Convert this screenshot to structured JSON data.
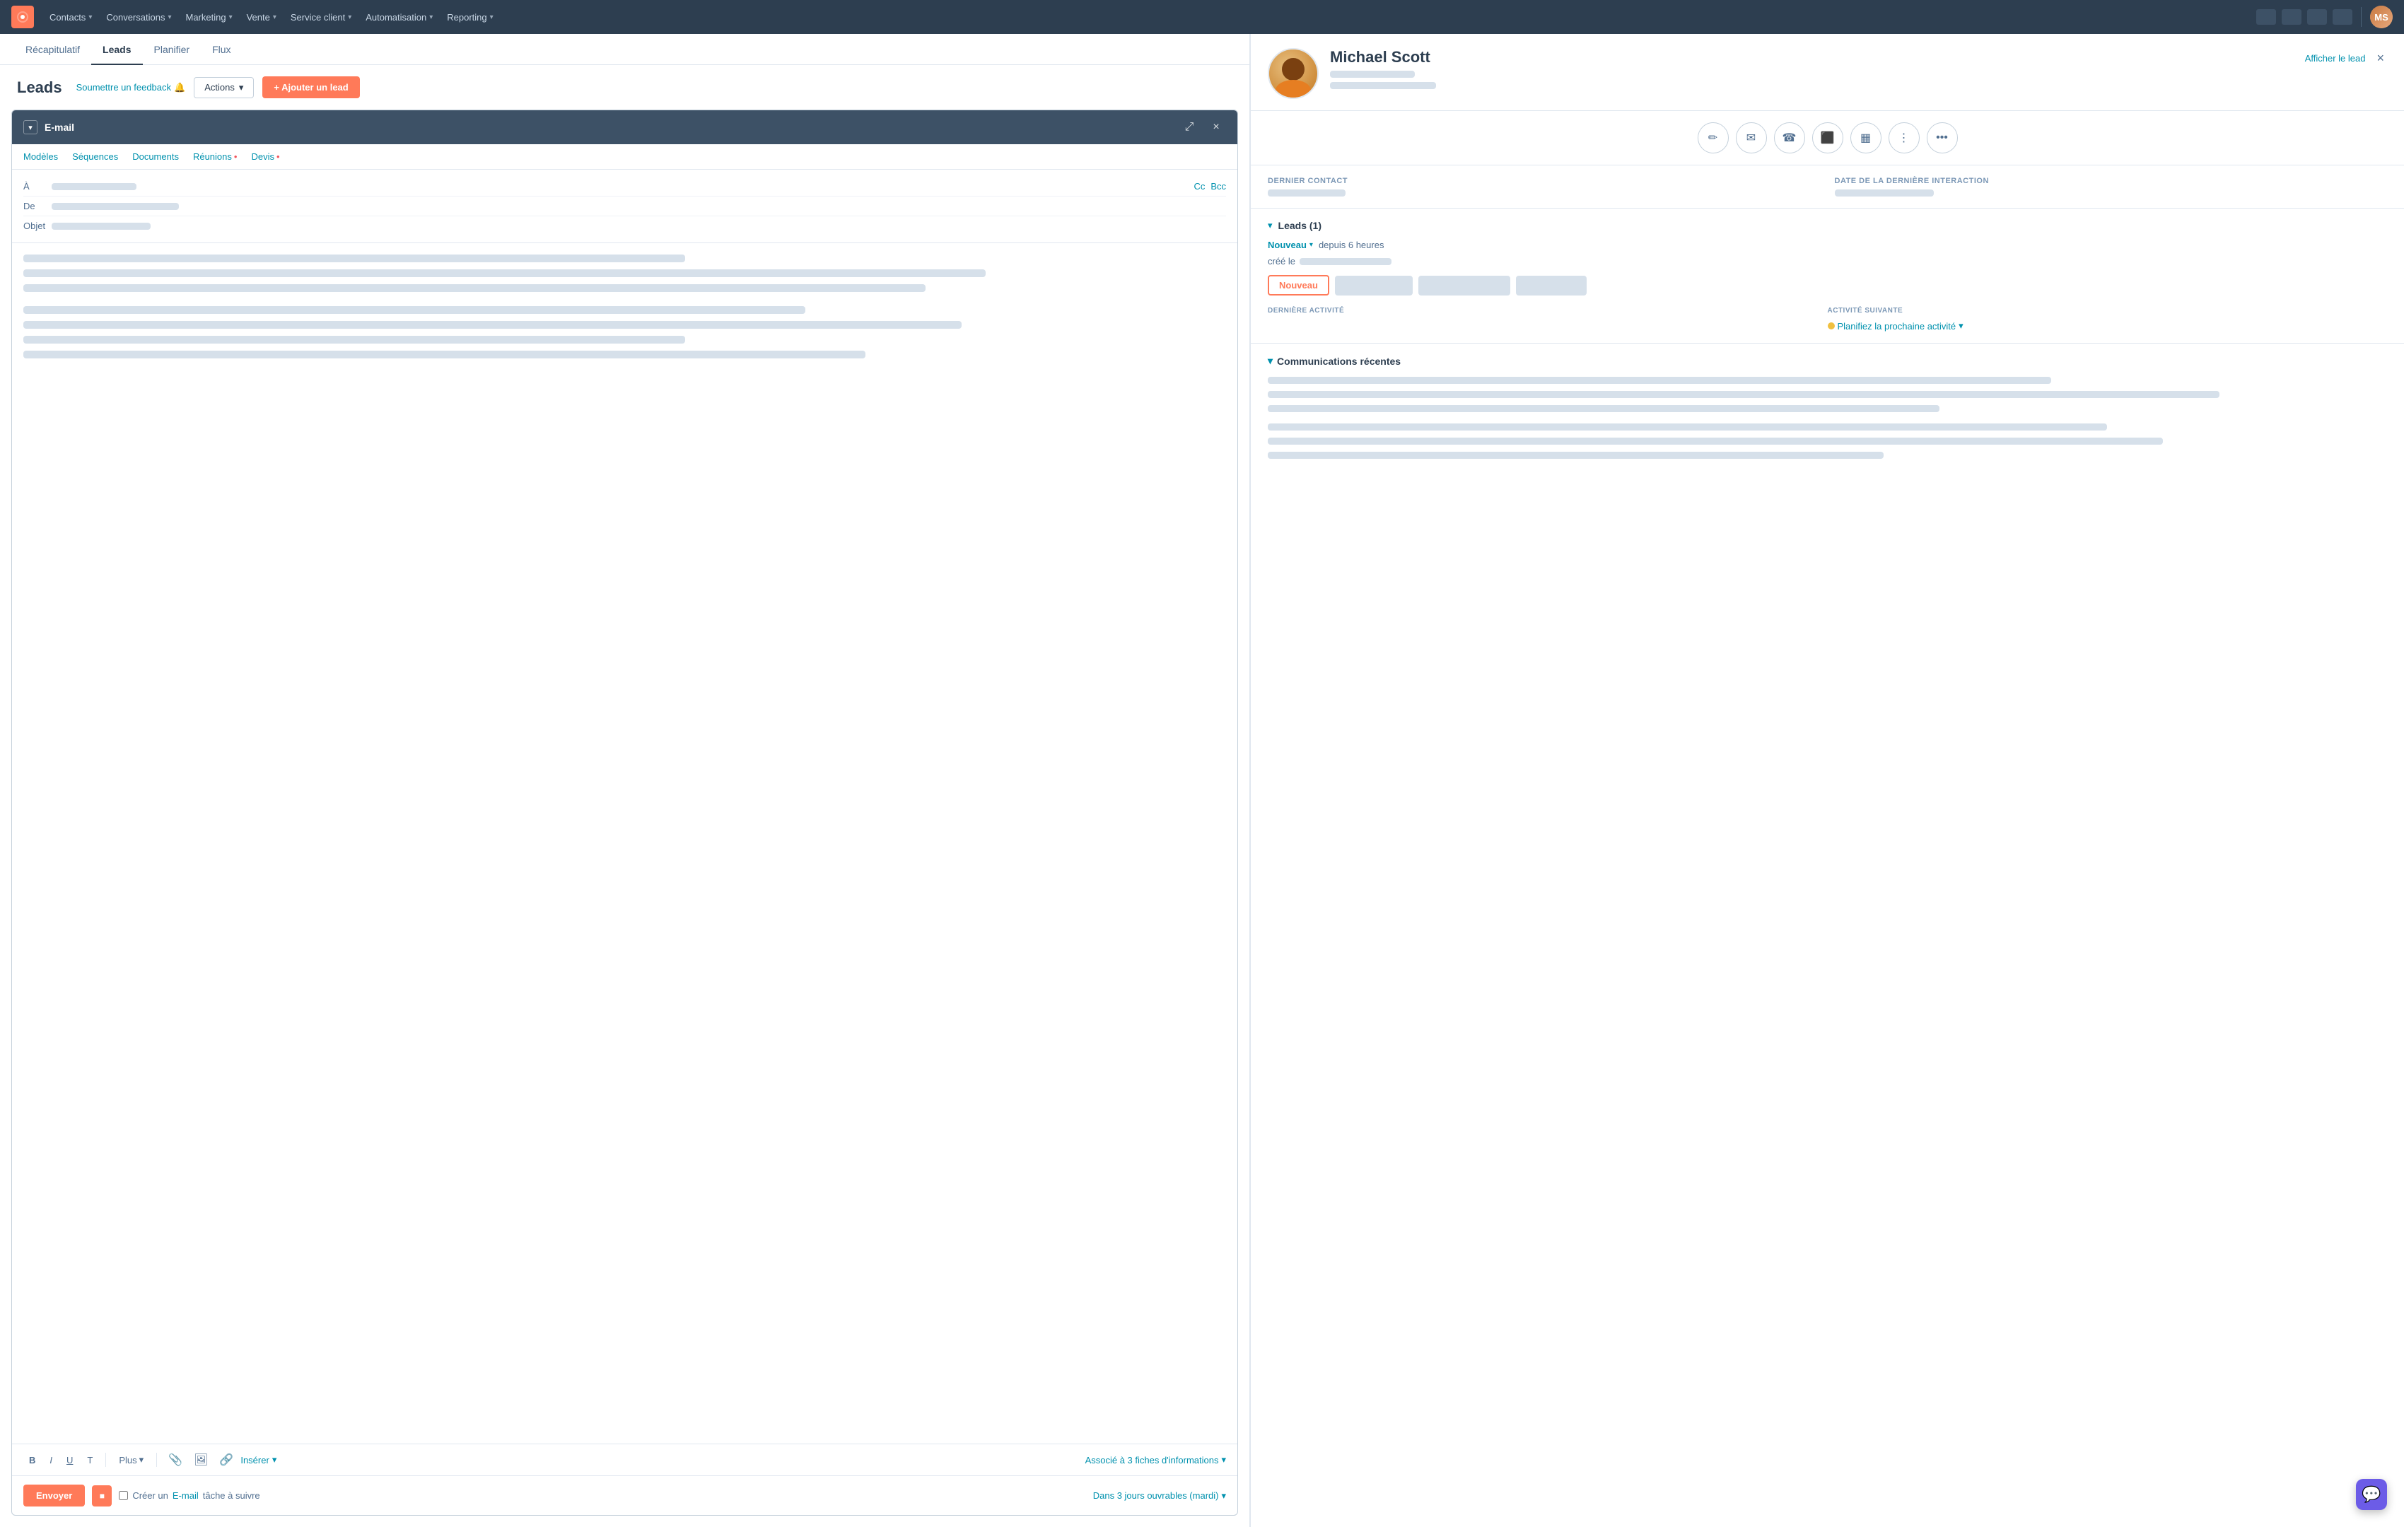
{
  "nav": {
    "logo": "H",
    "items": [
      {
        "label": "Contacts",
        "id": "contacts"
      },
      {
        "label": "Conversations",
        "id": "conversations"
      },
      {
        "label": "Marketing",
        "id": "marketing"
      },
      {
        "label": "Vente",
        "id": "vente"
      },
      {
        "label": "Service client",
        "id": "service"
      },
      {
        "label": "Automatisation",
        "id": "automatisation"
      },
      {
        "label": "Reporting",
        "id": "reporting"
      }
    ]
  },
  "tabs": [
    {
      "label": "Récapitulatif",
      "id": "recap"
    },
    {
      "label": "Leads",
      "id": "leads",
      "active": true
    },
    {
      "label": "Planifier",
      "id": "planifier"
    },
    {
      "label": "Flux",
      "id": "flux"
    }
  ],
  "leads": {
    "title": "Leads",
    "feedback_label": "Soumettre un feedback",
    "actions_label": "Actions",
    "add_lead_label": "+ Ajouter un lead"
  },
  "email_panel": {
    "header_title": "E-mail",
    "toolbar_items": [
      {
        "label": "Modèles",
        "id": "modeles"
      },
      {
        "label": "Séquences",
        "id": "sequences"
      },
      {
        "label": "Documents",
        "id": "documents"
      },
      {
        "label": "Réunions",
        "id": "reunions",
        "has_dot": true
      },
      {
        "label": "Devis",
        "id": "devis",
        "has_dot": true
      }
    ],
    "field_a_label": "À",
    "field_de_label": "De",
    "cc_label": "Cc",
    "bcc_label": "Bcc",
    "objet_label": "Objet",
    "format_buttons": [
      {
        "label": "B",
        "id": "bold",
        "type": "bold"
      },
      {
        "label": "I",
        "id": "italic",
        "type": "italic"
      },
      {
        "label": "U",
        "id": "underline",
        "type": "underline"
      },
      {
        "label": "T",
        "id": "strikethrough",
        "type": "strikethrough"
      }
    ],
    "plus_label": "Plus",
    "insert_label": "Insérer",
    "assoc_label": "Associé à 3 fiches d'informations",
    "send_label": "Envoyer",
    "create_label": "Créer un",
    "task_type_label": "E-mail",
    "task_follow_label": "tâche à suivre",
    "schedule_label": "Dans 3 jours ouvrables (mardi)"
  },
  "contact": {
    "name": "Michael Scott",
    "view_lead_label": "Afficher le lead",
    "close_label": "×",
    "action_icons": [
      {
        "id": "edit",
        "symbol": "✏",
        "label": "edit-icon"
      },
      {
        "id": "email",
        "symbol": "✉",
        "label": "email-icon"
      },
      {
        "id": "phone",
        "symbol": "📞",
        "label": "phone-icon"
      },
      {
        "id": "screen",
        "symbol": "⬛",
        "label": "screen-icon"
      },
      {
        "id": "calendar",
        "symbol": "📅",
        "label": "calendar-icon"
      },
      {
        "id": "dots-vert",
        "symbol": "⋮",
        "label": "dots-vertical-icon"
      },
      {
        "id": "more",
        "symbol": "•••",
        "label": "more-icon"
      }
    ],
    "last_contact_label": "Dernier contact",
    "last_interaction_label": "Date de la dernière interaction",
    "leads_section_title": "Leads (1)",
    "status_badge": "Nouveau",
    "since_text": "depuis 6 heures",
    "created_label": "créé le",
    "pipeline_btn": "Nouveau",
    "last_activity_label": "DERNIÈRE ACTIVITÉ",
    "next_activity_label": "ACTIVITÉ SUIVANTE",
    "planify_label": "Planifiez la prochaine activité",
    "comm_section_title": "Communications récentes"
  }
}
